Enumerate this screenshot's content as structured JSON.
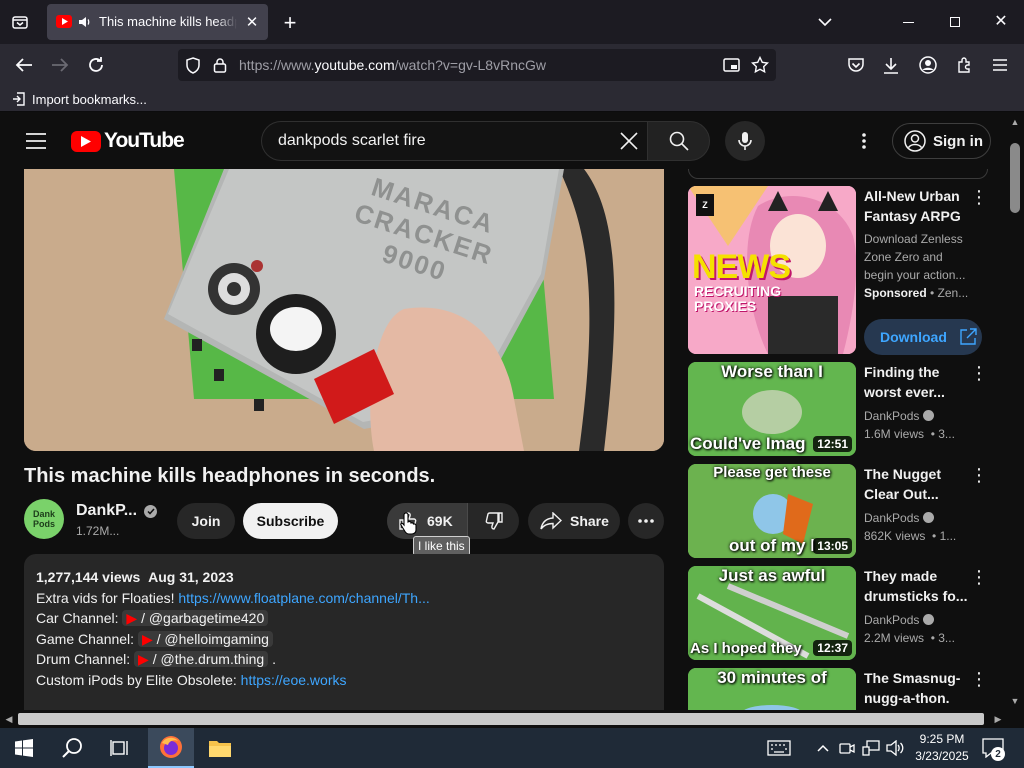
{
  "browser": {
    "tab_title": "This machine kills headphones in seconds.",
    "url_prefix": "https://www.",
    "url_domain": "youtube.com",
    "url_path": "/watch?v=gv-L8vRncGw",
    "bookmark": "Import bookmarks..."
  },
  "youtube": {
    "logo_text": "YouTube",
    "search_value": "dankpods scarlet fire",
    "sign_in": "Sign in",
    "video_title": "This machine kills headphones in seconds.",
    "channel_name": "DankP...",
    "channel_avatar_text": "Dank Pods",
    "subscribers": "1.72M...",
    "join": "Join",
    "subscribe": "Subscribe",
    "likes": "69K",
    "like_tooltip": "I like this",
    "share": "Share",
    "video_overlay_text": "MARACA CRACKER 9000",
    "description": {
      "views": "1,277,144 views",
      "date": "Aug 31, 2023",
      "line1_text": "Extra vids for Floaties! ",
      "line1_link": "https://www.floatplane.com/channel/Th...",
      "car_label": "Car Channel:",
      "car_handle": "/ @garbagetime420",
      "game_label": "Game Channel:",
      "game_handle": "/ @helloimgaming",
      "drum_label": "Drum Channel:",
      "drum_handle": "/ @the.drum.thing",
      "drum_suffix": ".",
      "ipods_text": "Custom iPods by Elite Obsolete: ",
      "ipods_link": "https://eoe.works"
    },
    "recommendations": [
      {
        "title": "All-New Urban Fantasy ARPG",
        "desc": "Download Zenless Zone Zero and begin your action...",
        "sponsored": "Sponsored",
        "sponsor": "• Zen...",
        "button": "Download",
        "thumb_text": "NEWS",
        "thumb_sub": "RECRUITING PROXIES"
      },
      {
        "title": "Finding the worst ever...",
        "channel": "DankPods",
        "views": "1.6M views",
        "age": "• 3...",
        "duration": "12:51",
        "thumb_top": "Worse than I",
        "thumb_bottom": "Could've Imag"
      },
      {
        "title": "The Nugget Clear Out...",
        "channel": "DankPods",
        "views": "862K views",
        "age": "• 1...",
        "duration": "13:05",
        "thumb_top": "Please get these",
        "thumb_bottom": "out of my l"
      },
      {
        "title": "They made drumsticks fo...",
        "channel": "DankPods",
        "views": "2.2M views",
        "age": "• 3...",
        "duration": "12:37",
        "thumb_top": "Just as awful",
        "thumb_bottom": "As I hoped they"
      },
      {
        "title": "The Smasnug-nugg-a-thon.",
        "thumb_top": "30 minutes of"
      }
    ]
  },
  "taskbar": {
    "time": "9:25 PM",
    "date": "3/23/2025",
    "notifications": "2"
  }
}
